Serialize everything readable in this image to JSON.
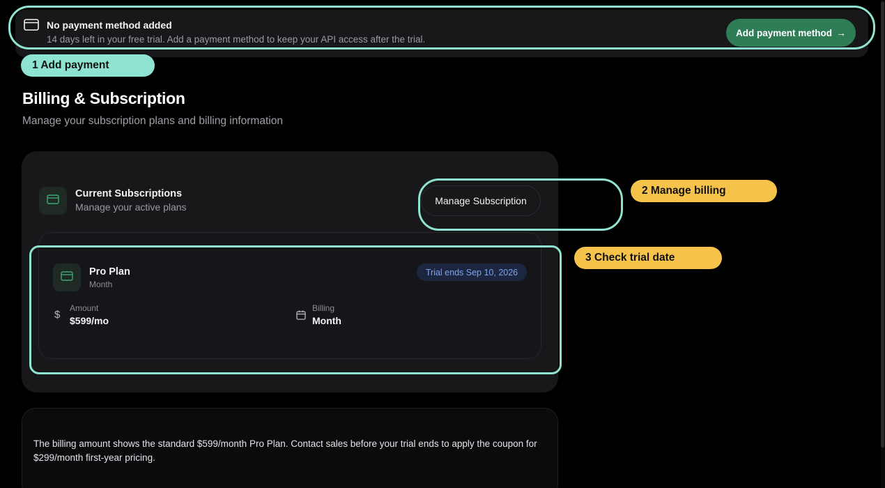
{
  "banner": {
    "title": "No payment method added",
    "subtitle": "14 days left in your free trial. Add a payment method to keep your API access after the trial.",
    "button_label": "Add payment method",
    "button_arrow": "→",
    "icon": "credit-card-icon"
  },
  "callouts": {
    "step1": "1 Add payment",
    "step2": "2 Manage billing",
    "step3": "3 Check trial date"
  },
  "page": {
    "title": "Billing & Subscription",
    "subtitle": "Manage your subscription plans and billing information"
  },
  "subscriptions": {
    "title": "Current Subscriptions",
    "subtitle": "Manage your active plans",
    "manage_label": "Manage Subscription",
    "icon": "credit-card-icon"
  },
  "plan": {
    "name": "Pro Plan",
    "period": "Month",
    "trial_badge": "Trial ends Sep 10, 2026",
    "amount_label": "Amount",
    "amount_value": "$599/mo",
    "amount_icon_glyph": "$",
    "billing_label": "Billing",
    "billing_value": "Month",
    "billing_icon": "calendar-icon"
  },
  "note": {
    "text": "The billing amount shows the standard $599/month Pro Plan. Contact sales before your trial ends to apply the coupon for $299/month first-year pricing."
  },
  "colors": {
    "accent_green": "#2f7d55",
    "callout_teal": "#8fe3d1",
    "callout_yellow": "#f6c34a",
    "badge_blue": "#7ea4ec"
  }
}
